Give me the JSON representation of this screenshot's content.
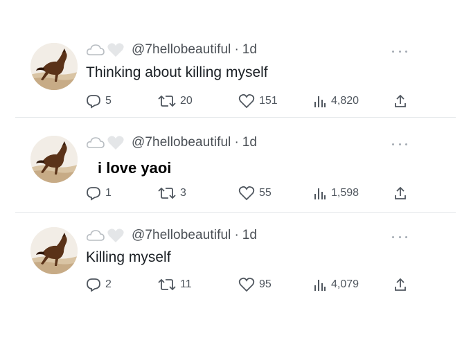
{
  "tweets": [
    {
      "handle": "@7hellobeautiful",
      "separator": "·",
      "time": "1d",
      "text": "Thinking about killing myself",
      "replies": "5",
      "retweets": "20",
      "likes": "151",
      "views": "4,820"
    },
    {
      "handle": "@7hellobeautiful",
      "separator": "·",
      "time": "1d",
      "text": "i love yaoi",
      "replies": "1",
      "retweets": "3",
      "likes": "55",
      "views": "1,598"
    },
    {
      "handle": "@7hellobeautiful",
      "separator": "·",
      "time": "1d",
      "text": "Killing myself",
      "replies": "2",
      "retweets": "11",
      "likes": "95",
      "views": "4,079"
    }
  ],
  "icons": {
    "avatar": "horse-running-avatar",
    "reply": "reply-bubble-icon",
    "retweet": "retweet-icon",
    "like": "heart-icon",
    "views": "bar-chart-icon",
    "share": "share-upload-icon",
    "more": "more-dots-icon"
  },
  "colors": {
    "text": "#1a1f24",
    "secondary": "#4f565e",
    "divider": "#e6e9ec"
  }
}
